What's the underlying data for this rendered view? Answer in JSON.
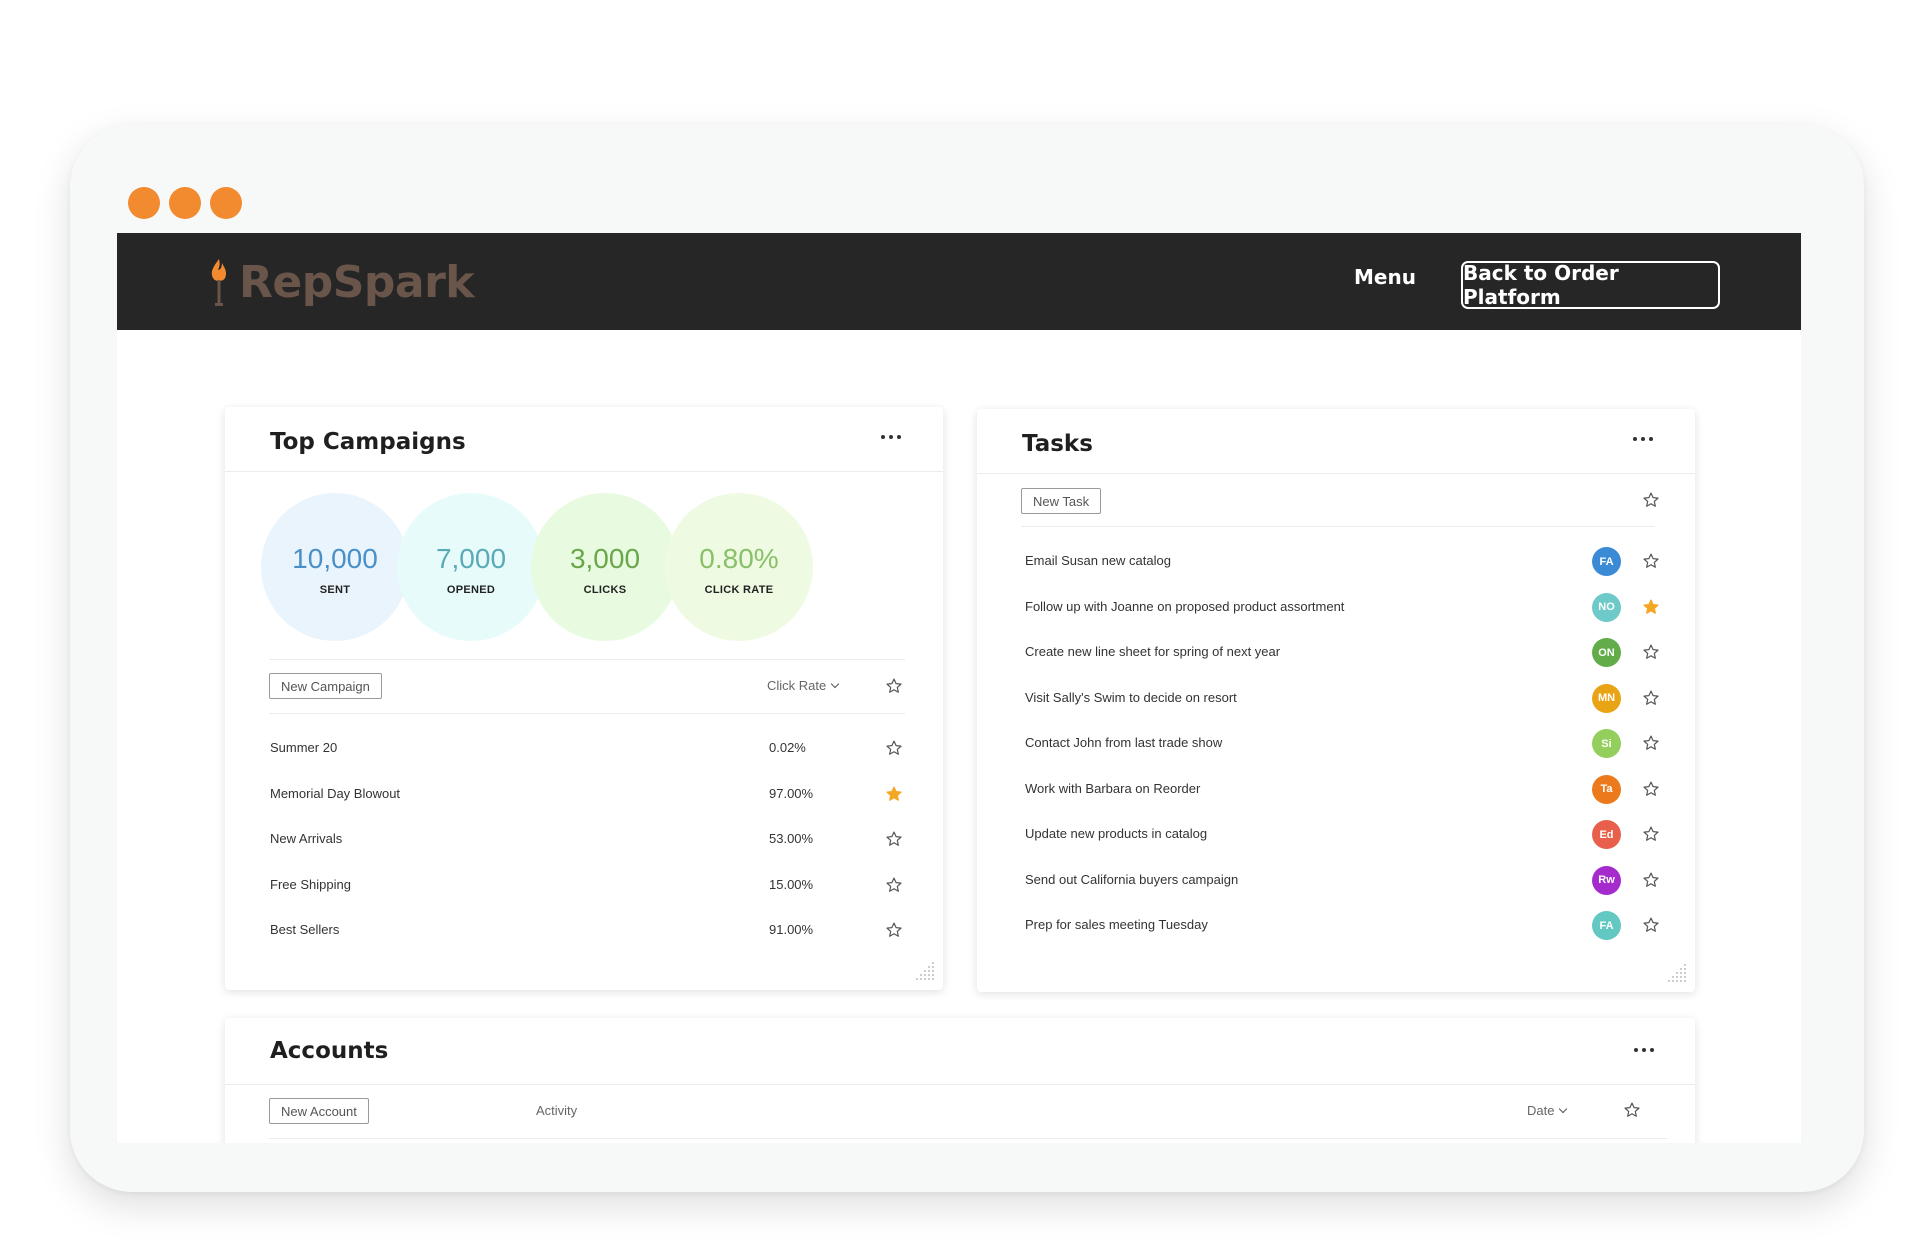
{
  "header": {
    "brand": "RepSpark",
    "menu_label": "Menu",
    "back_label": "Back to Order Platform"
  },
  "colors": {
    "window_dot": "#f28a30",
    "header_bg": "#262626",
    "brand_text": "#6a554b",
    "star_active": "#f5a623"
  },
  "campaigns": {
    "title": "Top Campaigns",
    "stats": [
      {
        "value": "10,000",
        "label": "SENT",
        "color": "#4a90c8",
        "bg": "#eaf4fc"
      },
      {
        "value": "7,000",
        "label": "OPENED",
        "color": "#5aaab8",
        "bg": "#e8fbfb"
      },
      {
        "value": "3,000",
        "label": "CLICKS",
        "color": "#6aa64a",
        "bg": "#e8fbe0"
      },
      {
        "value": "0.80%",
        "label": "CLICK RATE",
        "color": "#8ac06a",
        "bg": "#eefbe2"
      }
    ],
    "new_label": "New Campaign",
    "sort_label": "Click Rate",
    "rows": [
      {
        "name": "Summer 20",
        "rate": "0.02%",
        "starred": false
      },
      {
        "name": "Memorial Day Blowout",
        "rate": "97.00%",
        "starred": true
      },
      {
        "name": "New Arrivals",
        "rate": "53.00%",
        "starred": false
      },
      {
        "name": "Free Shipping",
        "rate": "15.00%",
        "starred": false
      },
      {
        "name": "Best Sellers",
        "rate": "91.00%",
        "starred": false
      }
    ]
  },
  "tasks": {
    "title": "Tasks",
    "new_label": "New Task",
    "rows": [
      {
        "text": "Email Susan new catalog",
        "initials": "FA",
        "color": "#3a8ad6",
        "starred": false
      },
      {
        "text": "Follow up with Joanne on proposed product assortment",
        "initials": "NO",
        "color": "#6ec9c9",
        "starred": true
      },
      {
        "text": "Create new line sheet for spring of next year",
        "initials": "ON",
        "color": "#62ad4a",
        "starred": false
      },
      {
        "text": "Visit Sally's Swim to decide on resort",
        "initials": "MN",
        "color": "#e8a415",
        "starred": false
      },
      {
        "text": "Contact John from last trade show",
        "initials": "Si",
        "color": "#94cf5e",
        "starred": false
      },
      {
        "text": "Work with Barbara on Reorder",
        "initials": "Ta",
        "color": "#ec7a1c",
        "starred": false
      },
      {
        "text": "Update new products in catalog",
        "initials": "Ed",
        "color": "#e8604c",
        "starred": false
      },
      {
        "text": "Send out California buyers campaign",
        "initials": "Rw",
        "color": "#a52bcc",
        "starred": false
      },
      {
        "text": "Prep for sales meeting Tuesday",
        "initials": "FA",
        "color": "#63c8c2",
        "starred": false
      }
    ]
  },
  "accounts": {
    "title": "Accounts",
    "new_label": "New Account",
    "activity_label": "Activity",
    "date_label": "Date"
  },
  "icons": {
    "more": "more-horizontal-icon",
    "star": "star-icon",
    "logo": "flame-icon",
    "resize": "resize-grip-icon"
  }
}
